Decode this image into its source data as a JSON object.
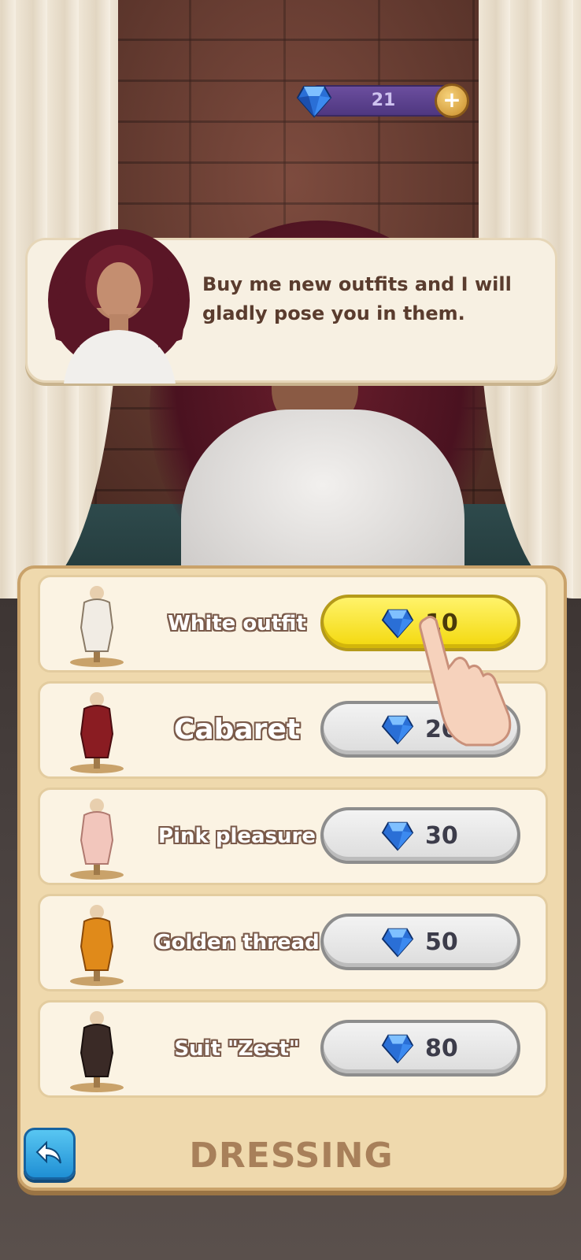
{
  "currency": {
    "gems": "21",
    "add_label": "+"
  },
  "dialog": {
    "text": "Buy me new outfits and I will gladly pose you in them."
  },
  "shop": {
    "title": "DRESSING",
    "items": [
      {
        "name": "White outfit",
        "price": "10",
        "dress_color": "#f1ece4",
        "highlighted": true
      },
      {
        "name": "Cabaret",
        "price": "20",
        "dress_color": "#8a1c22",
        "highlighted": false
      },
      {
        "name": "Pink pleasure",
        "price": "30",
        "dress_color": "#f2c6bc",
        "highlighted": false
      },
      {
        "name": "Golden thread",
        "price": "50",
        "dress_color": "#e08a1a",
        "highlighted": false
      },
      {
        "name": "Suit \"Zest\"",
        "price": "80",
        "dress_color": "#3a2a26",
        "highlighted": false
      }
    ]
  },
  "colors": {
    "accent_yellow": "#f3d80c",
    "panel": "#efd9ad",
    "back_button": "#1f8fd4"
  },
  "icons": [
    "gem-icon",
    "plus-icon",
    "back-arrow-icon",
    "tap-hand-icon"
  ]
}
